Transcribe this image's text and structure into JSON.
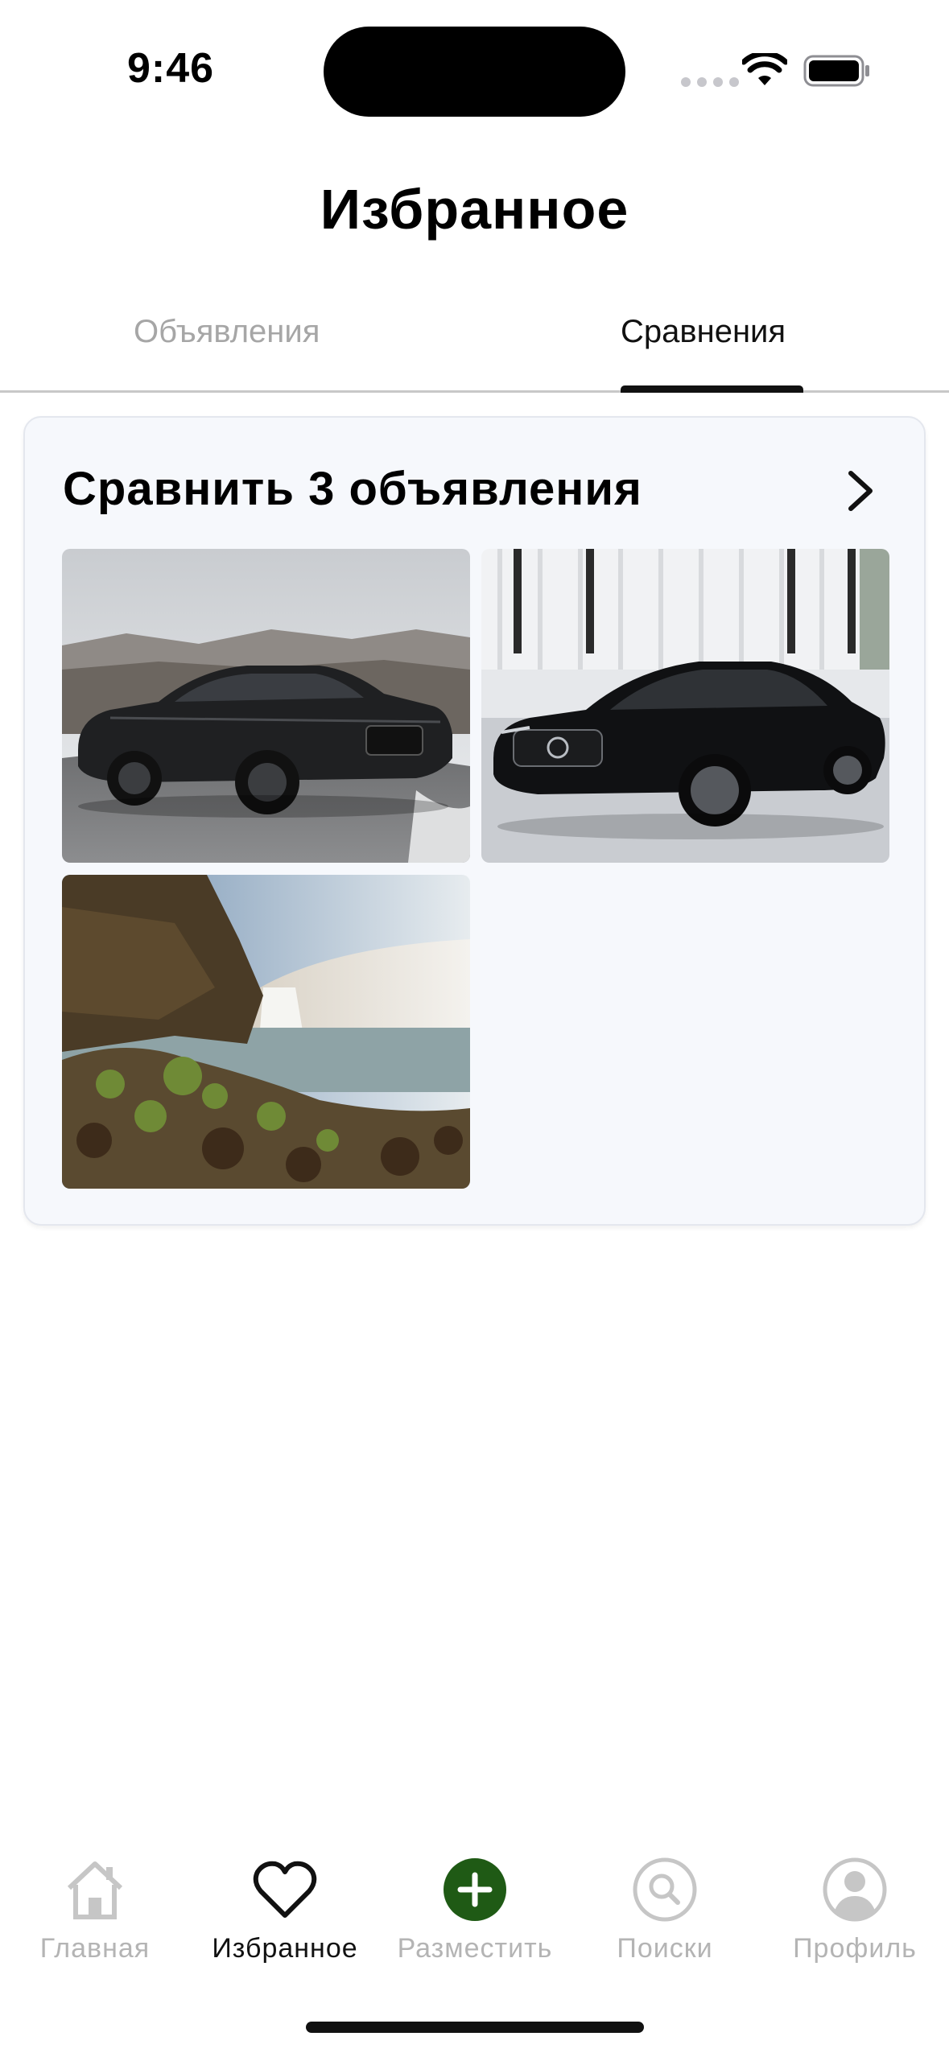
{
  "status_bar": {
    "time": "9:46"
  },
  "page": {
    "title": "Избранное"
  },
  "tabs": [
    {
      "label": "Объявления",
      "active": false
    },
    {
      "label": "Сравнения",
      "active": true
    }
  ],
  "compare_card": {
    "title": "Сравнить 3 объявления",
    "images": [
      {
        "alt": "black-sedan-mountain-road"
      },
      {
        "alt": "black-sedan-showroom"
      },
      {
        "alt": "waterfall-landscape"
      }
    ]
  },
  "bottom_nav": {
    "items": [
      {
        "label": "Главная",
        "icon": "home-icon",
        "active": false
      },
      {
        "label": "Избранное",
        "icon": "heart-icon",
        "active": true
      },
      {
        "label": "Разместить",
        "icon": "plus-circle-icon",
        "active": false
      },
      {
        "label": "Поиски",
        "icon": "search-icon",
        "active": false
      },
      {
        "label": "Профиль",
        "icon": "profile-icon",
        "active": false
      }
    ]
  },
  "colors": {
    "accent_green": "#1f5a15",
    "inactive_gray": "#b4b4b4",
    "card_background": "#f6f8fc"
  }
}
